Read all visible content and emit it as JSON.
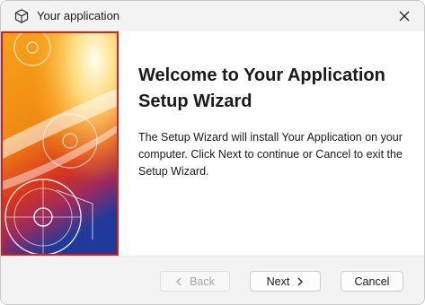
{
  "window": {
    "title": "Your application"
  },
  "content": {
    "heading": "Welcome to Your Application Setup Wizard",
    "body": "The Setup Wizard will install Your Application on your computer. Click Next to continue or Cancel to exit the Setup Wizard."
  },
  "buttons": {
    "back_label": "Back",
    "next_label": "Next",
    "cancel_label": "Cancel"
  },
  "colors": {
    "accent_border": "#d61f1f",
    "titlebar_bg": "#f3f3f3"
  },
  "icons": [
    "app-cube-icon",
    "close-icon",
    "chevron-left-icon",
    "chevron-right-icon"
  ]
}
